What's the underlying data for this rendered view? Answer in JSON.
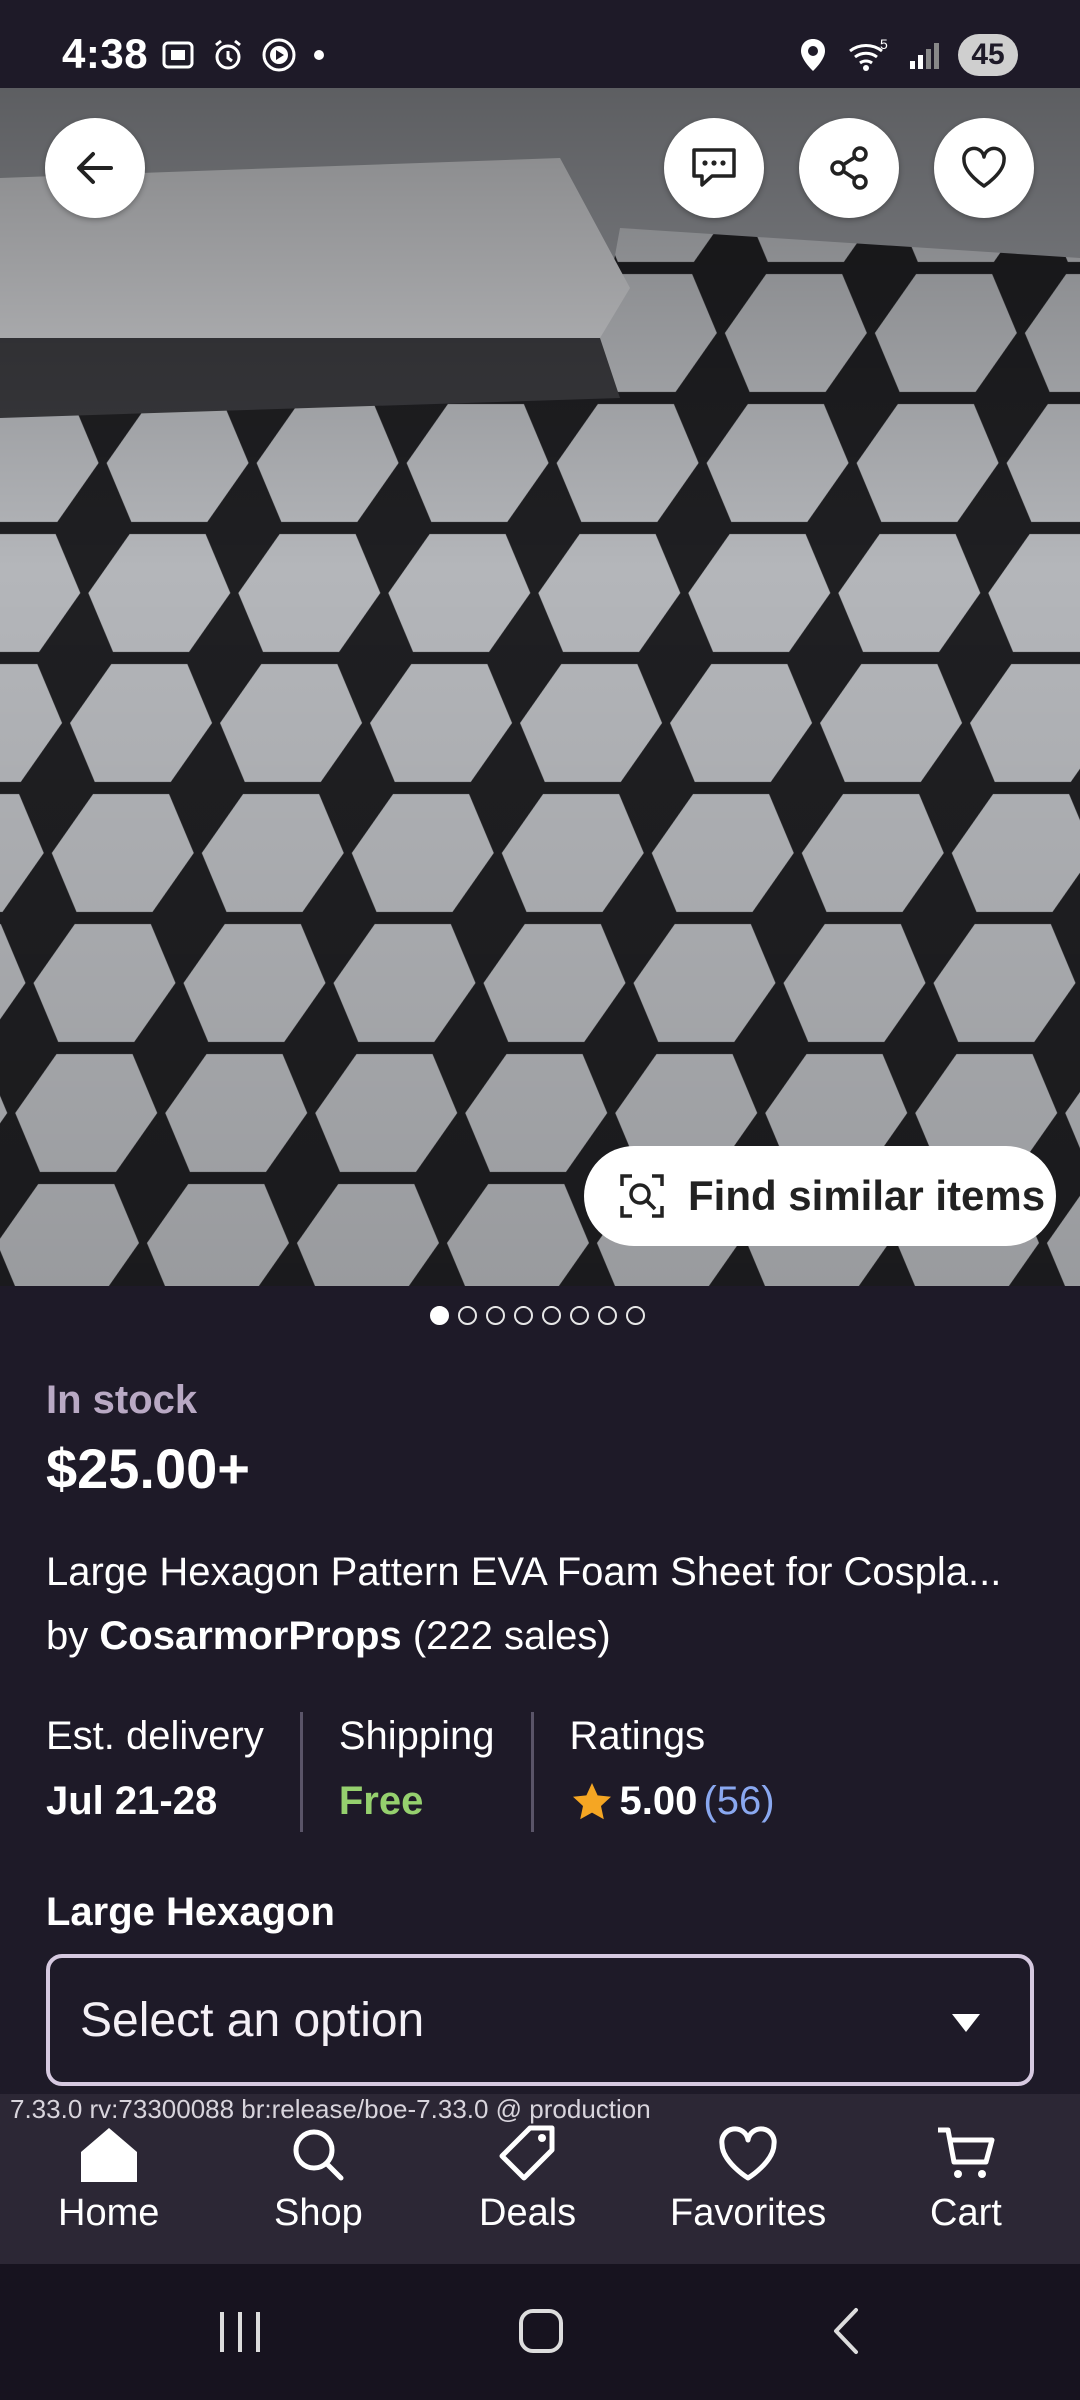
{
  "status": {
    "time": "4:38",
    "battery": "45",
    "signal_label": "5"
  },
  "hero": {
    "find_similar_label": "Find similar items",
    "image_count": 8,
    "active_image_index": 0
  },
  "product": {
    "stock_status": "In stock",
    "price": "$25.00+",
    "title": "Large Hexagon Pattern EVA Foam Sheet for Cospla...",
    "by_prefix": "by",
    "shop_name": "CosarmorProps",
    "sales": "(222 sales)"
  },
  "info": {
    "delivery_label": "Est. delivery",
    "delivery_value": "Jul 21-28",
    "shipping_label": "Shipping",
    "shipping_value": "Free",
    "ratings_label": "Ratings",
    "ratings_value": "5.00",
    "ratings_count": "(56)"
  },
  "variation": {
    "label": "Large Hexagon",
    "select_placeholder": "Select an option"
  },
  "build_info": "7.33.0 rv:73300088 br:release/boe-7.33.0 @ production",
  "tabs": [
    {
      "label": "Home",
      "icon": "home-icon"
    },
    {
      "label": "Shop",
      "icon": "search-icon"
    },
    {
      "label": "Deals",
      "icon": "tag-icon"
    },
    {
      "label": "Favorites",
      "icon": "heart-icon"
    },
    {
      "label": "Cart",
      "icon": "cart-icon"
    }
  ],
  "colors": {
    "background": "#1e1a28",
    "in_stock": "#b9a9c4",
    "free": "#95d06e",
    "star": "#f5a623",
    "ratings_count": "#8aa8f0"
  }
}
